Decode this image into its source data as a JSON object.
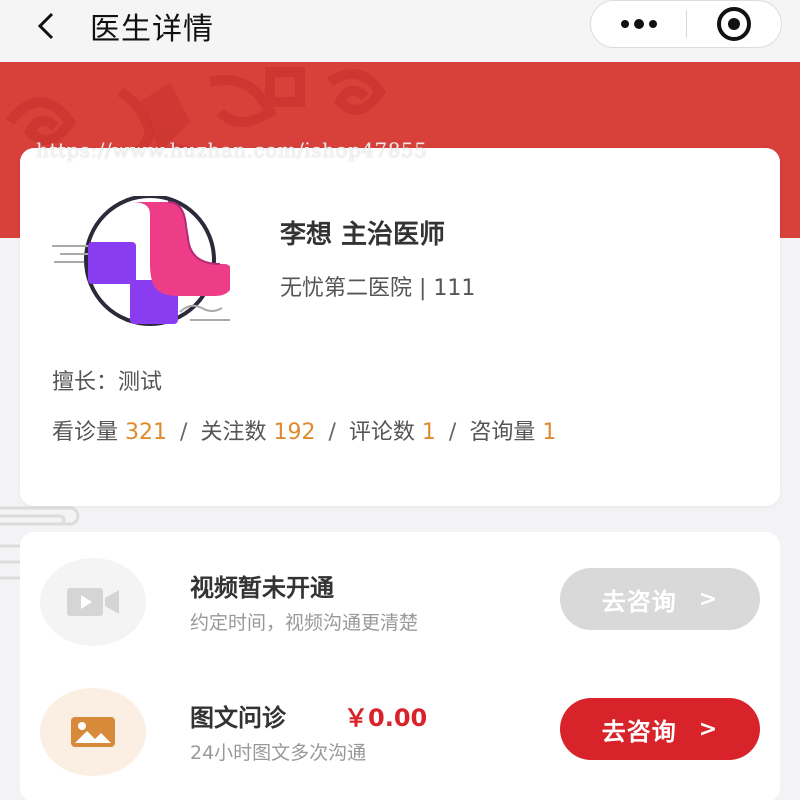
{
  "nav": {
    "title": "医生详情",
    "back_icon": "chevron-left-icon",
    "more_icon": "more-dots-icon",
    "close_icon": "target-circle-icon"
  },
  "watermark": "https://www.huzhan.com/ishop47855",
  "doctor": {
    "name_title": "李想 主治医师",
    "hospital_dept": "无忧第二医院 | 111",
    "specialty_label": "擅长：",
    "specialty_value": "测试",
    "stats": [
      {
        "label": "看诊量",
        "value": "321"
      },
      {
        "label": "关注数",
        "value": "192"
      },
      {
        "label": "评论数",
        "value": "1"
      },
      {
        "label": "咨询量",
        "value": "1"
      }
    ],
    "stat_separator": "/"
  },
  "services": {
    "video": {
      "title": "视频暂未开通",
      "desc": "约定时间，视频沟通更清楚",
      "button": "去咨询",
      "icon": "video-camera-icon"
    },
    "text": {
      "title": "图文问诊",
      "price": "￥0.00",
      "desc": "24小时图文多次沟通",
      "button": "去咨询",
      "icon": "image-icon"
    },
    "button_arrow": ">"
  },
  "colors": {
    "banner_red": "#d8403a",
    "accent_orange": "#e08a2c",
    "price_red": "#d9232b",
    "disabled_gray": "#d9d9d9"
  }
}
